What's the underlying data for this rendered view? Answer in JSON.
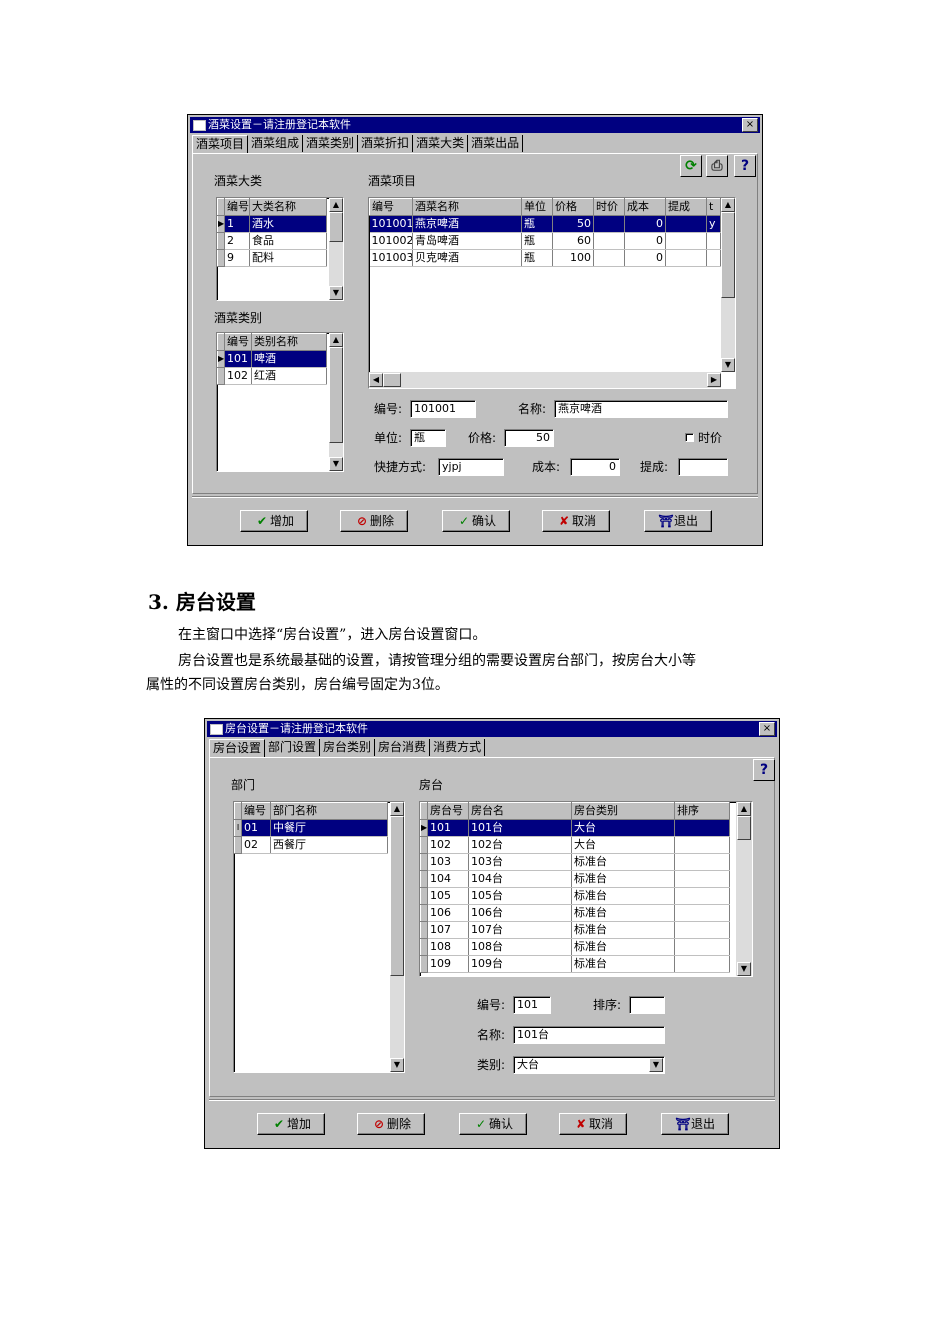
{
  "win1": {
    "title": "酒菜设置－请注册登记本软件",
    "close": "×",
    "tabs": [
      "酒菜项目",
      "酒菜组成",
      "酒菜类别",
      "酒菜折扣",
      "酒菜大类",
      "酒菜出品"
    ],
    "toolbar": {
      "refresh": "⟳",
      "print": "⎙",
      "help": "?"
    },
    "category_label": "酒菜大类",
    "category_headers": [
      "编号",
      "大类名称"
    ],
    "categories": [
      [
        "1",
        "酒水"
      ],
      [
        "2",
        "食品"
      ],
      [
        "9",
        "配料"
      ]
    ],
    "type_label": "酒菜类别",
    "type_headers": [
      "编号",
      "类别名称"
    ],
    "types": [
      [
        "101",
        "啤酒"
      ],
      [
        "102",
        "红酒"
      ]
    ],
    "items_label": "酒菜项目",
    "item_headers": [
      "编号",
      "酒菜名称",
      "单位",
      "价格",
      "时价",
      "成本",
      "提成",
      "t"
    ],
    "items": [
      [
        "101001",
        "燕京啤酒",
        "瓶",
        "50",
        "",
        "0",
        "",
        "y"
      ],
      [
        "101002",
        "青岛啤酒",
        "瓶",
        "60",
        "",
        "0",
        "",
        ""
      ],
      [
        "101003",
        "贝克啤酒",
        "瓶",
        "100",
        "",
        "0",
        "",
        ""
      ]
    ],
    "form": {
      "code_label": "编号:",
      "code": "101001",
      "name_label": "名称:",
      "name": "燕京啤酒",
      "unit_label": "单位:",
      "unit": "瓶",
      "price_label": "价格:",
      "price": "50",
      "market_label": "时价",
      "shortcut_label": "快捷方式:",
      "shortcut": "yjpj",
      "cost_label": "成本:",
      "cost": "0",
      "commission_label": "提成:",
      "commission": ""
    },
    "buttons": {
      "add": "增加",
      "delete": "删除",
      "confirm": "确认",
      "cancel": "取消",
      "exit": "退出"
    }
  },
  "section": {
    "heading": "3. 房台设置",
    "p1": "在主窗口中选择“房台设置”，进入房台设置窗口。",
    "p2a": "房台设置也是系统最基础的设置，请按管理分组的需要设置房台部门，按房台大小等",
    "p2b": "属性的不同设置房台类别，房台编号固定为3位。"
  },
  "win2": {
    "title": "房台设置－请注册登记本软件",
    "close": "×",
    "tabs": [
      "房台设置",
      "部门设置",
      "房台类别",
      "房台消费",
      "消费方式"
    ],
    "help": "?",
    "dept_label": "部门",
    "dept_headers": [
      "编号",
      "部门名称"
    ],
    "depts": [
      [
        "01",
        "中餐厅"
      ],
      [
        "02",
        "西餐厅"
      ]
    ],
    "room_label": "房台",
    "room_headers": [
      "房台号",
      "房台名",
      "房台类别",
      "排序"
    ],
    "rooms": [
      [
        "101",
        "101台",
        "大台",
        ""
      ],
      [
        "102",
        "102台",
        "大台",
        ""
      ],
      [
        "103",
        "103台",
        "标准台",
        ""
      ],
      [
        "104",
        "104台",
        "标准台",
        ""
      ],
      [
        "105",
        "105台",
        "标准台",
        ""
      ],
      [
        "106",
        "106台",
        "标准台",
        ""
      ],
      [
        "107",
        "107台",
        "标准台",
        ""
      ],
      [
        "108",
        "108台",
        "标准台",
        ""
      ],
      [
        "109",
        "109台",
        "标准台",
        ""
      ]
    ],
    "form": {
      "code_label": "编号:",
      "code": "101",
      "order_label": "排序:",
      "order": "",
      "name_label": "名称:",
      "name": "101台",
      "type_label": "类别:",
      "type": "大台"
    },
    "buttons": {
      "add": "增加",
      "delete": "删除",
      "confirm": "确认",
      "cancel": "取消",
      "exit": "退出"
    }
  }
}
